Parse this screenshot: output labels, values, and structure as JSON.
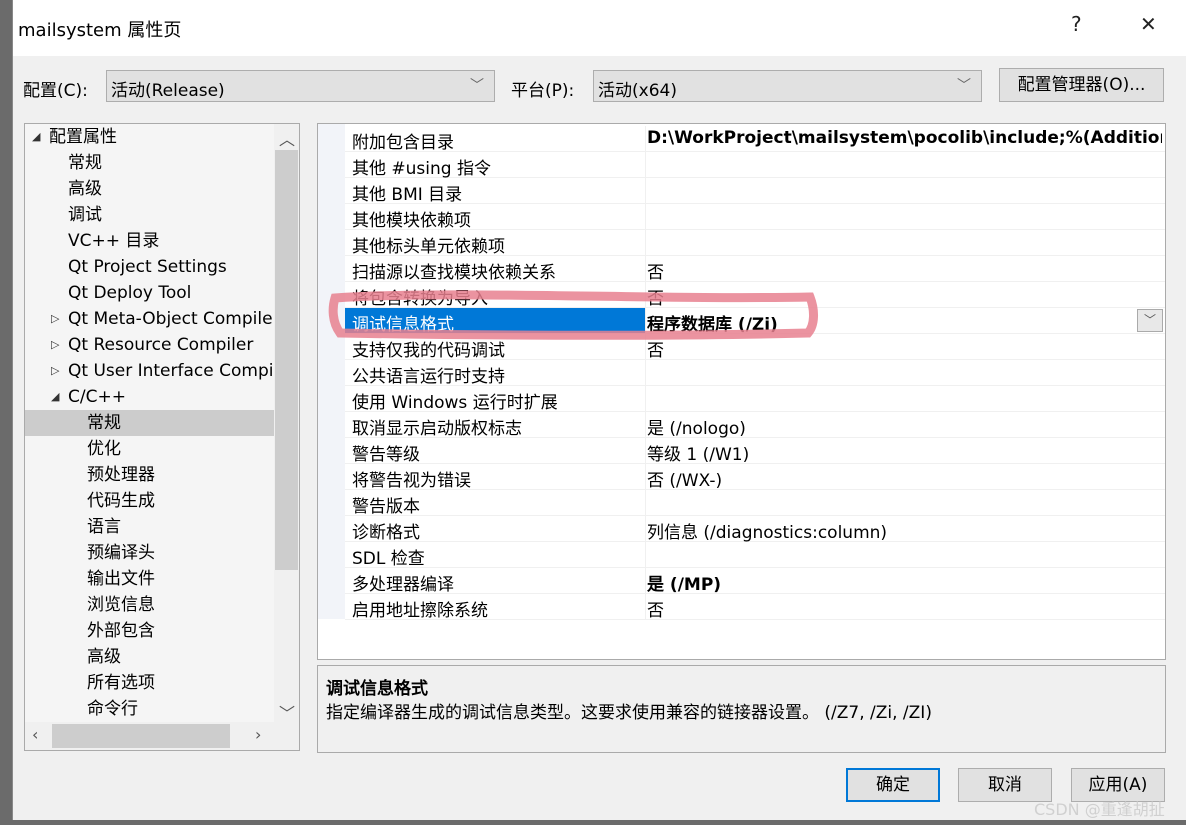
{
  "window": {
    "title": "mailsystem 属性页",
    "help": "?",
    "close": "✕"
  },
  "config": {
    "label": "配置(C):",
    "value": "活动(Release)",
    "platform_label": "平台(P):",
    "platform_value": "活动(x64)",
    "manager_button": "配置管理器(O)..."
  },
  "tree": {
    "items": [
      {
        "label": "配置属性",
        "level": 0,
        "expander": "expanded"
      },
      {
        "label": "常规",
        "level": 1
      },
      {
        "label": "高级",
        "level": 1
      },
      {
        "label": "调试",
        "level": 1
      },
      {
        "label": "VC++ 目录",
        "level": 1
      },
      {
        "label": "Qt Project Settings",
        "level": 1
      },
      {
        "label": "Qt Deploy Tool",
        "level": 1
      },
      {
        "label": "Qt Meta-Object Compiler",
        "level": 1,
        "expander": "collapsed"
      },
      {
        "label": "Qt Resource Compiler",
        "level": 1,
        "expander": "collapsed"
      },
      {
        "label": "Qt User Interface Compiler",
        "level": 1,
        "expander": "collapsed"
      },
      {
        "label": "C/C++",
        "level": 1,
        "expander": "expanded"
      },
      {
        "label": "常规",
        "level": 2,
        "selected": true
      },
      {
        "label": "优化",
        "level": 2
      },
      {
        "label": "预处理器",
        "level": 2
      },
      {
        "label": "代码生成",
        "level": 2
      },
      {
        "label": "语言",
        "level": 2
      },
      {
        "label": "预编译头",
        "level": 2
      },
      {
        "label": "输出文件",
        "level": 2
      },
      {
        "label": "浏览信息",
        "level": 2
      },
      {
        "label": "外部包含",
        "level": 2
      },
      {
        "label": "高级",
        "level": 2
      },
      {
        "label": "所有选项",
        "level": 2
      },
      {
        "label": "命令行",
        "level": 2
      }
    ]
  },
  "properties": [
    {
      "name": "附加包含目录",
      "value": "D:\\WorkProject\\mailsystem\\pocolib\\include;%(AdditionalIncludeDirectories)",
      "bold": true
    },
    {
      "name": "其他 #using 指令",
      "value": ""
    },
    {
      "name": "其他 BMI 目录",
      "value": ""
    },
    {
      "name": "其他模块依赖项",
      "value": ""
    },
    {
      "name": "其他标头单元依赖项",
      "value": ""
    },
    {
      "name": "扫描源以查找模块依赖关系",
      "value": "否"
    },
    {
      "name": "将包含转换为导入",
      "value": "否"
    },
    {
      "name": "调试信息格式",
      "value": "程序数据库 (/Zi)",
      "bold": true,
      "selected": true
    },
    {
      "name": "支持仅我的代码调试",
      "value": "否"
    },
    {
      "name": "公共语言运行时支持",
      "value": ""
    },
    {
      "name": "使用 Windows 运行时扩展",
      "value": ""
    },
    {
      "name": "取消显示启动版权标志",
      "value": "是 (/nologo)"
    },
    {
      "name": "警告等级",
      "value": "等级 1 (/W1)"
    },
    {
      "name": "将警告视为错误",
      "value": "否 (/WX-)"
    },
    {
      "name": "警告版本",
      "value": ""
    },
    {
      "name": "诊断格式",
      "value": "列信息 (/diagnostics:column)"
    },
    {
      "name": "SDL 检查",
      "value": ""
    },
    {
      "name": "多处理器编译",
      "value": "是 (/MP)",
      "bold": true
    },
    {
      "name": "启用地址擦除系统",
      "value": "否"
    }
  ],
  "description": {
    "title": "调试信息格式",
    "text": "指定编译器生成的调试信息类型。这要求使用兼容的链接器设置。   (/Z7, /Zi, /ZI)"
  },
  "buttons": {
    "ok": "确定",
    "cancel": "取消",
    "apply": "应用(A)"
  },
  "watermark": "CSDN @重逢胡扯",
  "colors": {
    "selection": "#0078d7",
    "annotation": "#e8808f",
    "focus_border": "#0078d7"
  }
}
